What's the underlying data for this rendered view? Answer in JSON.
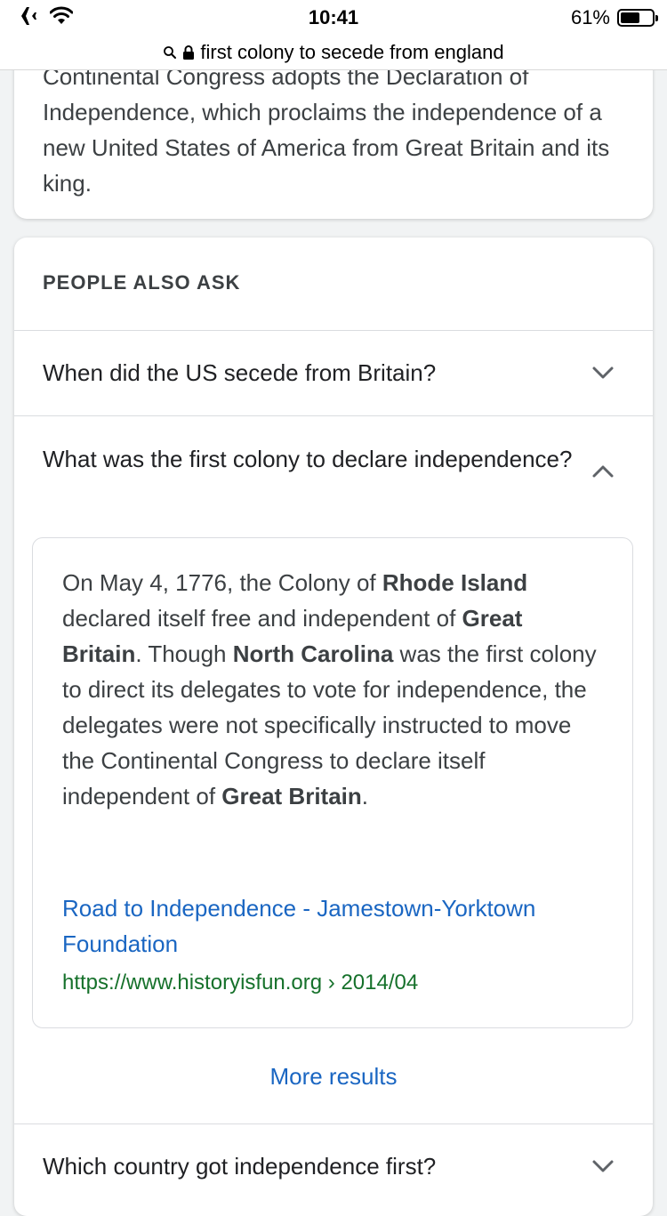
{
  "status_bar": {
    "time": "10:41",
    "battery": "61%",
    "battery_level": 0.61,
    "airplane_icon": "airplane-icon",
    "wifi_icon": "wifi-icon"
  },
  "url_bar": {
    "text": "first colony to secede from england"
  },
  "snippet_card": {
    "text": "Continental Congress adopts the Declaration of Independence, which proclaims the independence of a new United States of America from Great Britain and its king."
  },
  "people_also_ask": {
    "title": "PEOPLE ALSO ASK",
    "questions": [
      {
        "label": "When did the US secede from Britain?",
        "expanded": false
      },
      {
        "label": "What was the first colony to declare independence?",
        "expanded": true
      },
      {
        "label": "Which country got independence first?",
        "expanded": false
      }
    ],
    "answer": {
      "parts": [
        {
          "text": "On May 4, 1776, the Colony of ",
          "bold": false
        },
        {
          "text": "Rhode Island",
          "bold": true
        },
        {
          "text": " declared itself free and independent of ",
          "bold": false
        },
        {
          "text": "Great Britain",
          "bold": true
        },
        {
          "text": ". Though ",
          "bold": false
        },
        {
          "text": "North Carolina",
          "bold": true
        },
        {
          "text": " was the first colony to direct its delegates to vote for independence, the delegates were not specifically instructed to move the Continental Congress to declare itself independent of ",
          "bold": false
        },
        {
          "text": "Great Britain",
          "bold": true
        },
        {
          "text": ".",
          "bold": false
        }
      ],
      "source_title": "Road to Independence - Jamestown-Yorktown Foundation",
      "source_url": "https://www.historyisfun.org › 2014/04"
    },
    "more_results": "More results"
  },
  "colors": {
    "link": "#1a66c2",
    "url_green": "#16712b",
    "background": "#f1f3f4"
  }
}
